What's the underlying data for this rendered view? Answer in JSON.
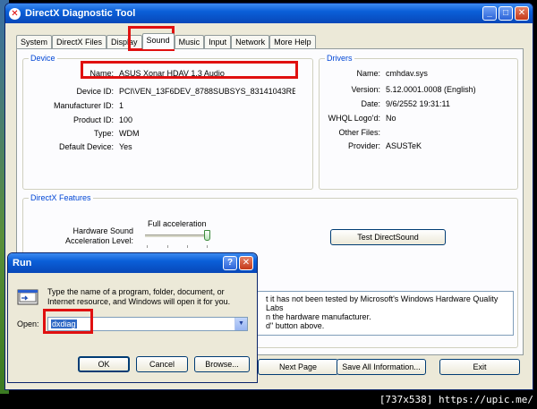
{
  "window": {
    "title": "DirectX Diagnostic Tool",
    "tabs": [
      "System",
      "DirectX Files",
      "Display",
      "Sound",
      "Music",
      "Input",
      "Network",
      "More Help"
    ],
    "active_tab": "Sound"
  },
  "device": {
    "group_title": "Device",
    "rows": [
      {
        "k": "Name:",
        "v": "ASUS Xonar HDAV 1.3 Audio"
      },
      {
        "k": "Device ID:",
        "v": "PCI\\VEN_13F6DEV_8788SUBSYS_83141043REV_0("
      },
      {
        "k": "Manufacturer ID:",
        "v": "1"
      },
      {
        "k": "Product ID:",
        "v": "100"
      },
      {
        "k": "Type:",
        "v": "WDM"
      },
      {
        "k": "Default Device:",
        "v": "Yes"
      }
    ]
  },
  "drivers": {
    "group_title": "Drivers",
    "rows": [
      {
        "k": "Name:",
        "v": "cmhdav.sys"
      },
      {
        "k": "Version:",
        "v": "5.12.0001.0008 (English)"
      },
      {
        "k": "Date:",
        "v": "9/6/2552 19:31:11"
      },
      {
        "k": "WHQL Logo'd:",
        "v": "No"
      },
      {
        "k": "Other Files:",
        "v": ""
      },
      {
        "k": "Provider:",
        "v": "ASUSTeK"
      }
    ]
  },
  "features": {
    "group_title": "DirectX Features",
    "hw_label_1": "Hardware Sound",
    "hw_label_2": "Acceleration Level:",
    "slider_value_label": "Full acceleration",
    "slider_level": 1.0,
    "test_button": "Test DirectSound"
  },
  "notes": {
    "line1": "t it has not been tested by Microsoft's Windows Hardware Quality Labs",
    "line2": "n the hardware manufacturer.",
    "line3": "d\" button above."
  },
  "bottom_buttons": {
    "next": "Next Page",
    "save": "Save All Information...",
    "exit": "Exit"
  },
  "run": {
    "title": "Run",
    "description": "Type the name of a program, folder, document, or Internet resource, and Windows will open it for you.",
    "open_label": "Open:",
    "open_value": "dxdiag",
    "ok": "OK",
    "cancel": "Cancel",
    "browse": "Browse..."
  },
  "watermark": "[737x538] https://upic.me/"
}
